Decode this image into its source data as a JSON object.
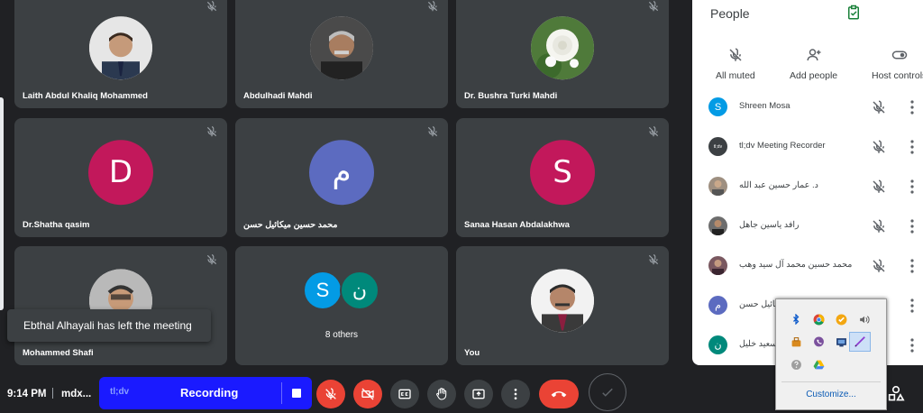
{
  "tiles": [
    {
      "name": "Laith Abdul Khaliq Mohammed"
    },
    {
      "name": "Abdulhadi Mahdi"
    },
    {
      "name": "Dr. Bushra Turki Mahdi"
    },
    {
      "name": "Dr.Shatha qasim",
      "initial": "D",
      "color": "#c2185b"
    },
    {
      "name": "محمد حسين ميكائيل حسن",
      "initial": "م",
      "color": "#5c6bc0"
    },
    {
      "name": "Sanaa Hasan Abdalakhwa",
      "initial": "S",
      "color": "#c2185b"
    },
    {
      "name": "Mohammed Shafi"
    },
    {
      "name": "8 others",
      "initials": [
        "S",
        "ن"
      ],
      "colors": [
        "#039be5",
        "#00897b"
      ]
    },
    {
      "name": "You"
    }
  ],
  "toast": "Ebthal Alhayali has left the meeting",
  "bottom_bar": {
    "time": "9:14 PM",
    "meeting_code": "mdx...",
    "recorder_brand": "tl;dv",
    "recording_label": "Recording"
  },
  "panel": {
    "title": "People",
    "actions": [
      "All muted",
      "Add people",
      "Host controls"
    ],
    "people": [
      {
        "name": "Shreen Mosa",
        "initial": "S",
        "color": "#039be5"
      },
      {
        "name": "tl;dv Meeting Recorder",
        "initial": "tl;dv",
        "color": "#3c4043"
      },
      {
        "name": "د. عمار حسين عبد الله",
        "photo": true
      },
      {
        "name": "رافد ياسين جاهل",
        "photo": true
      },
      {
        "name": "محمد حسين محمد آل سيد وهب",
        "photo": true
      },
      {
        "name": "محمد حسين ميكائيل حسن",
        "initial": "م",
        "color": "#5c6bc0"
      },
      {
        "name": "نصير سعيد خليل",
        "initial": "ن",
        "color": "#00897b"
      }
    ]
  },
  "tray": {
    "customize": "Customize..."
  }
}
